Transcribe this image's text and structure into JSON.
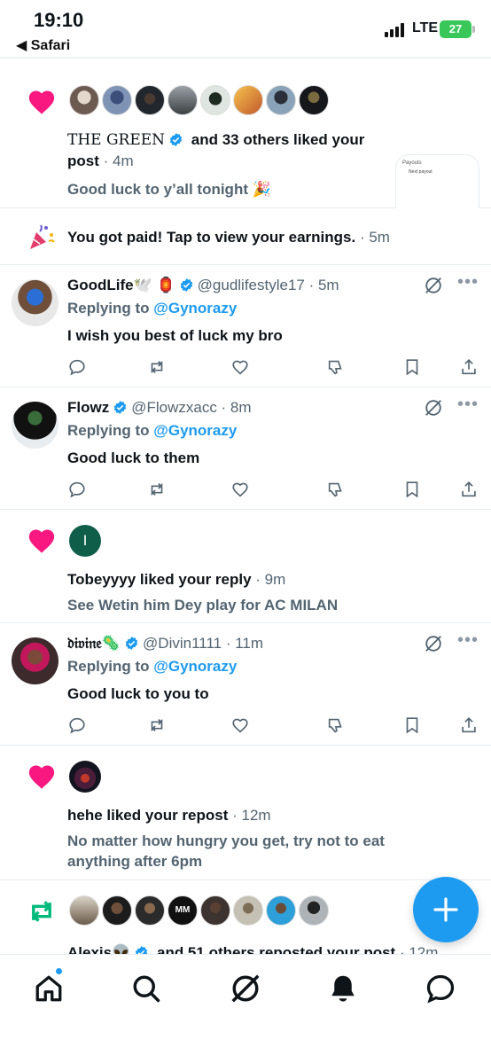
{
  "status_bar": {
    "time": "19:10",
    "back_app": "◀ Safari",
    "network": "LTE",
    "battery": "27"
  },
  "colors": {
    "like": "#f91880",
    "repost": "#00ba7c",
    "accent": "#1d9bf0",
    "text": "#0f1419",
    "secondary": "#536471"
  },
  "notif_like_1": {
    "first_name": "THE GREEN",
    "others": " and 33 others liked your",
    "post_word": "post",
    "time": " · 4m",
    "preview": "Good luck to y’all tonight 🎉",
    "card_title": "Payouts",
    "card_line": "Next payout"
  },
  "notif_paid": {
    "text": "You got paid! Tap to view your earnings.",
    "time": " · 5m"
  },
  "reply_1": {
    "name": "GoodLife🕊️ 🏮",
    "handle": "@gudlifestyle17",
    "time": " · 5m",
    "replying_label": "Replying to ",
    "replying_to": "@Gynorazy",
    "body": "I wish you best of luck my bro"
  },
  "reply_2": {
    "name": "Flowz",
    "handle": "@Flowzxacc",
    "time": " · 8m",
    "replying_label": "Replying to ",
    "replying_to": "@Gynorazy",
    "body": "Good luck to them"
  },
  "notif_like_2": {
    "avatar_letter": "I",
    "user": "Tobeyyyy",
    "action": " liked your reply",
    "time": " · 9m",
    "preview": "See Wetin him Dey play for AC MILAN"
  },
  "reply_3": {
    "name": "𝔡𝔦𝔳𝔦𝔫𝔢🦠",
    "handle": "@Divin1111",
    "time": " · 11m",
    "replying_label": "Replying to ",
    "replying_to": "@Gynorazy",
    "body": "Good luck to you to"
  },
  "notif_like_3": {
    "user": "hehe",
    "action": " liked your repost",
    "time": " · 12m",
    "preview_line1": "No matter how hungry you get, try not to eat",
    "preview_line2": "anything after 6pm"
  },
  "notif_repost": {
    "first_name": "Alexis👽",
    "others": " and 51 others reposted your post",
    "time": " · 12m",
    "badge_text": "MM"
  },
  "icons": [
    "heart-icon",
    "party-popper-icon",
    "verified-icon",
    "grok-icon",
    "more-icon",
    "reply-icon",
    "retweet-icon",
    "like-icon",
    "dislike-icon",
    "bookmark-icon",
    "share-icon",
    "compose-icon",
    "home-icon",
    "search-icon",
    "notifications-icon",
    "messages-icon"
  ]
}
